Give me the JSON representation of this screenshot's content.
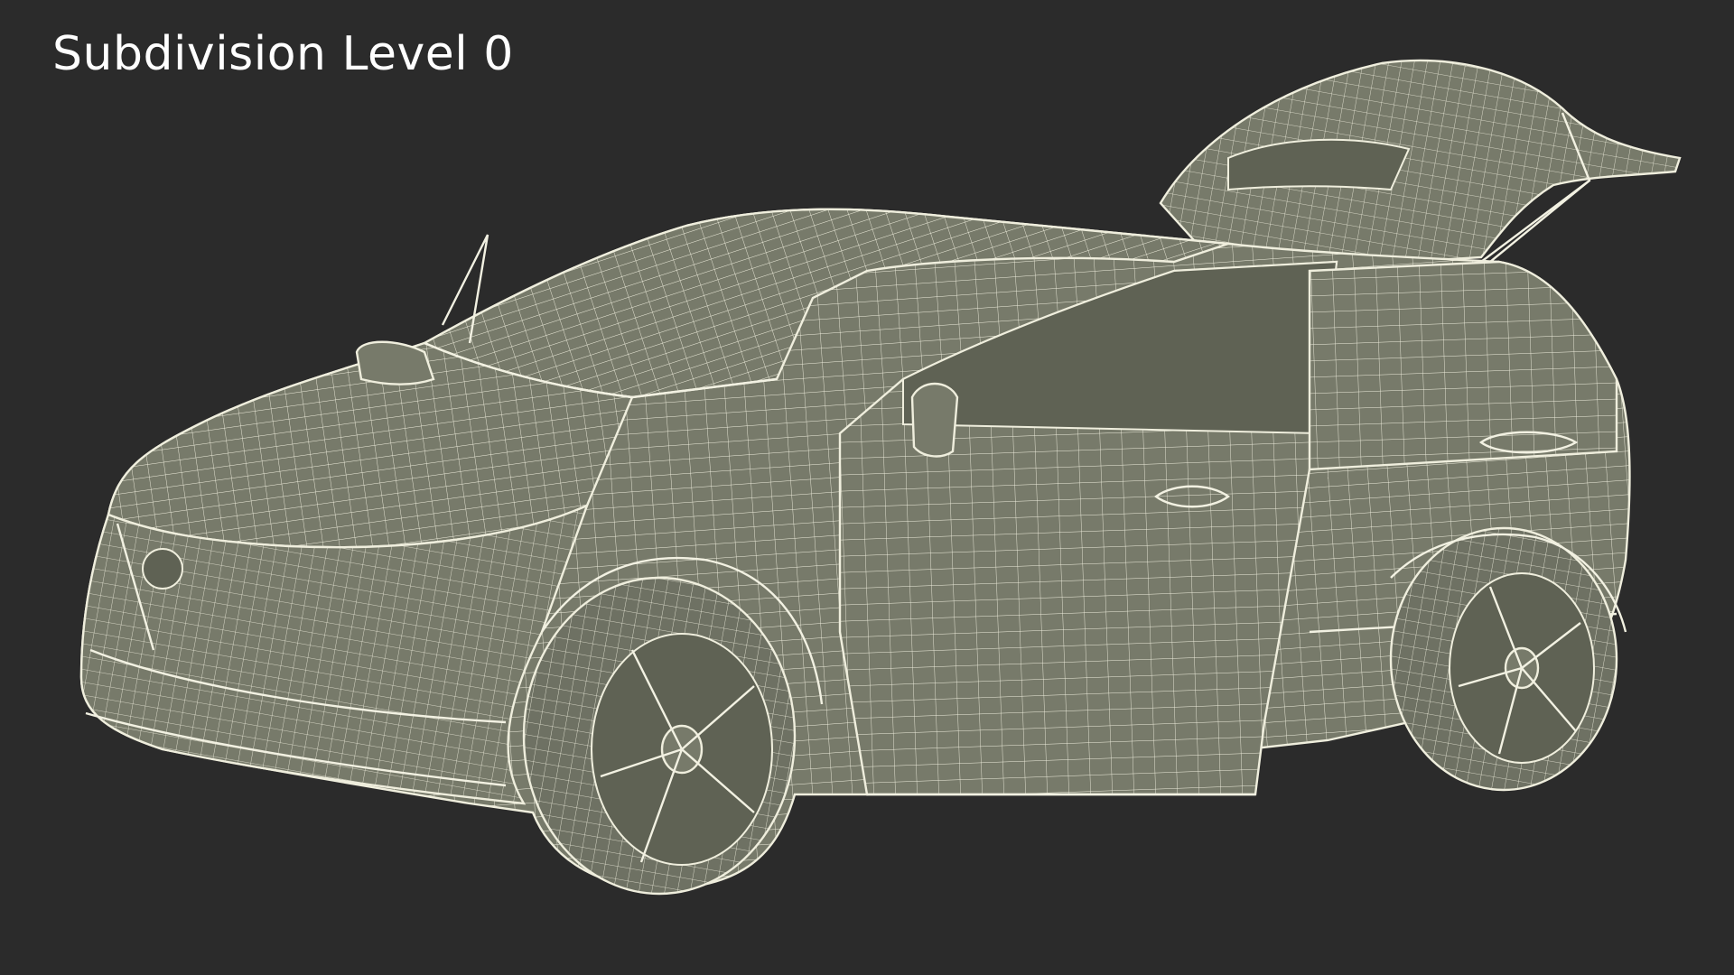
{
  "caption": "Subdivision Level 0",
  "colors": {
    "background": "#2b2b2b",
    "model_surface": "#777a6a",
    "wireframe": "#efeedd",
    "caption_text": "#ffffff"
  },
  "subject": "car-wireframe-render"
}
